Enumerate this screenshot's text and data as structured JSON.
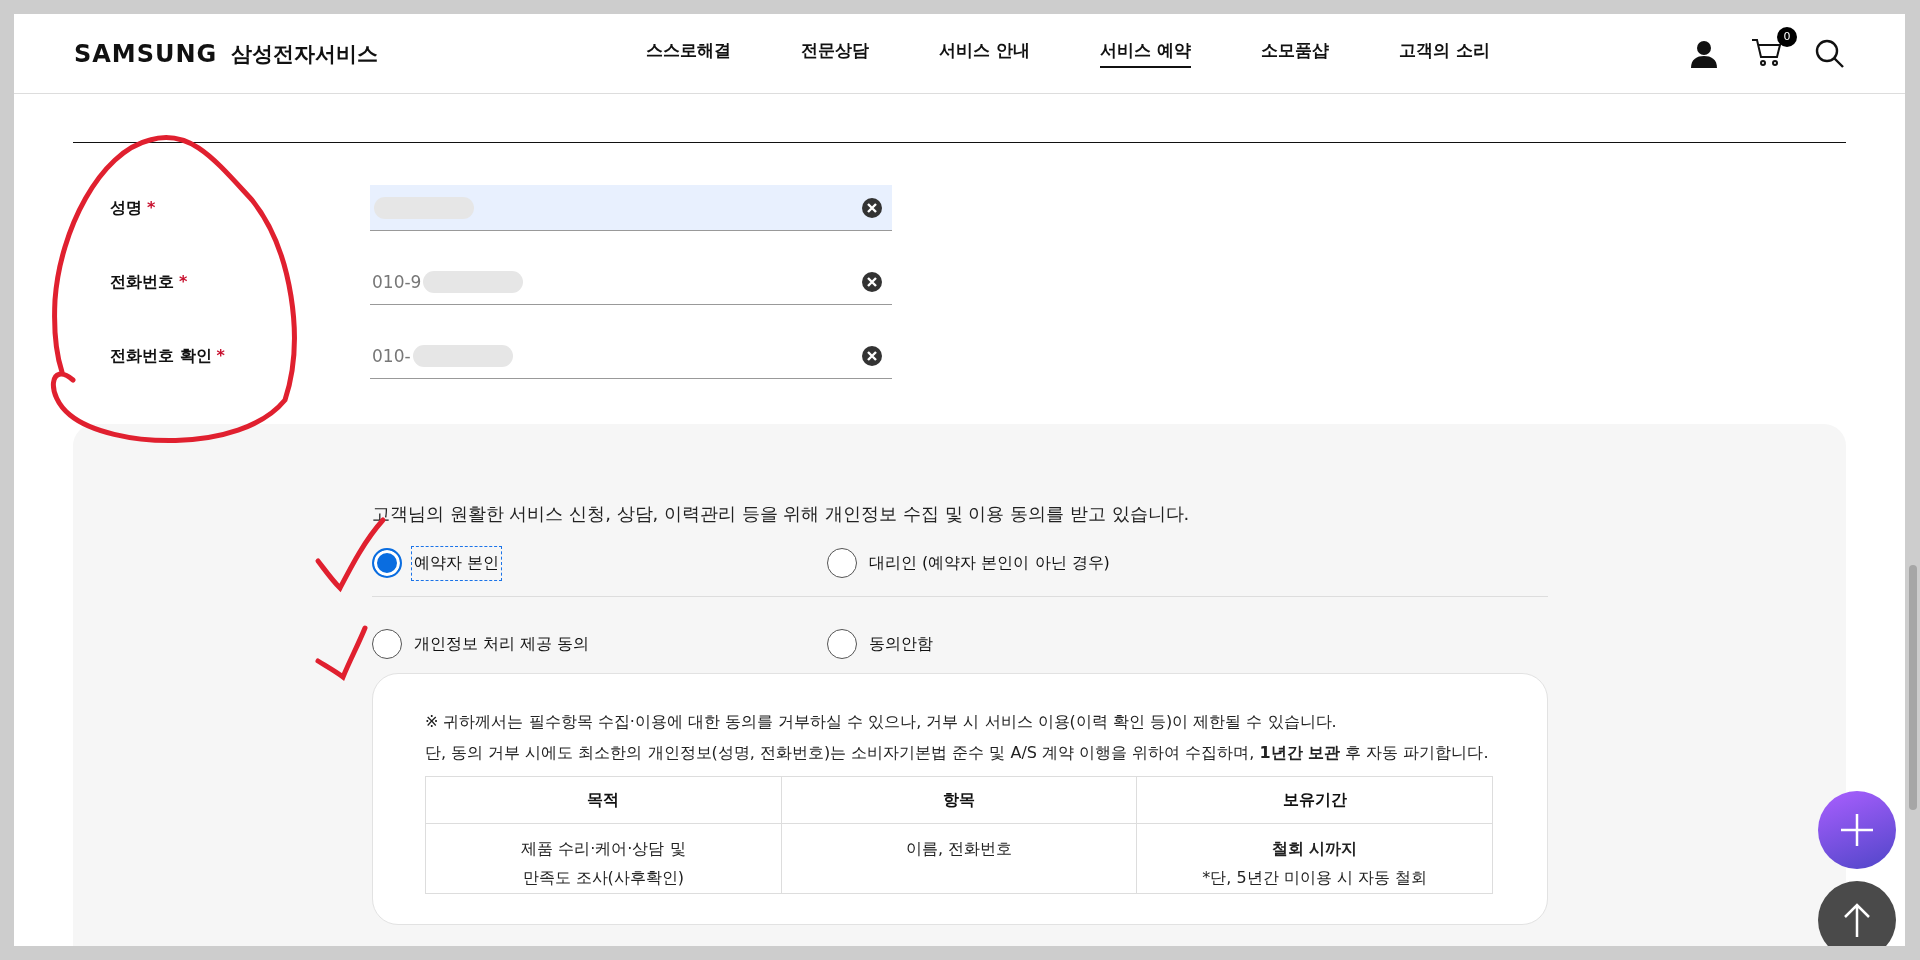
{
  "header": {
    "logo": "SAMSUNG",
    "service_name": "삼성전자서비스",
    "cart_count": "0",
    "nav": [
      {
        "label": "스스로해결",
        "selected": false
      },
      {
        "label": "전문상담",
        "selected": false
      },
      {
        "label": "서비스 안내",
        "selected": false
      },
      {
        "label": "서비스 예약",
        "selected": true
      },
      {
        "label": "소모품샵",
        "selected": false
      },
      {
        "label": "고객의 소리",
        "selected": false
      }
    ]
  },
  "form": {
    "required_mark": "*",
    "fields": [
      {
        "label": "성명",
        "required": true,
        "highlighted": true
      },
      {
        "label": "전화번호",
        "required": true,
        "highlighted": false,
        "value": "010-9"
      },
      {
        "label": "전화번호 확인",
        "required": true,
        "highlighted": false,
        "value": "010-"
      }
    ]
  },
  "consent": {
    "intro": "고객님의 원활한 서비스 신청, 상담, 이력관리 등을 위해 개인정보 수집 및 이용 동의를 받고 있습니다.",
    "groups": [
      {
        "options": [
          {
            "label": "예약자 본인",
            "selected": true,
            "focused": true
          },
          {
            "label": "대리인 (예약자 본인이 아닌 경우)",
            "selected": false,
            "focused": false
          }
        ]
      },
      {
        "options": [
          {
            "label": "개인정보 처리 제공 동의",
            "selected": false,
            "focused": false
          },
          {
            "label": "동의안함",
            "selected": false,
            "focused": false
          }
        ]
      }
    ],
    "notice": [
      "※ 귀하께서는 필수항목 수집·이용에 대한 동의를 거부하실 수 있으나, 거부 시 서비스 이용(이력 확인 등)이 제한될 수 있습니다.",
      "단, 동의 거부 시에도 최소한의 개인정보(성명, 전화번호)는 소비자기본법 준수 및 A/S 계약 이행을 위하여 수집하며, **1년간 보관** 후 자동 파기합니다."
    ],
    "table": {
      "columns": [
        "목적",
        "항목",
        "보유기간"
      ],
      "rows": [
        {
          "cells": [
            {
              "lines": [
                {
                  "text": "제품 수리·케어·상담 및",
                  "bold": false
                },
                {
                  "text": "만족도 조사(사후확인)",
                  "bold": false
                }
              ]
            },
            {
              "lines": [
                {
                  "text": "이름, 전화번호",
                  "bold": false
                }
              ]
            },
            {
              "lines": [
                {
                  "text": "철회 시까지",
                  "bold": true
                },
                {
                  "text": "*단, 5년간 미이용 시 자동 철회",
                  "bold": false
                }
              ]
            }
          ]
        }
      ]
    }
  }
}
